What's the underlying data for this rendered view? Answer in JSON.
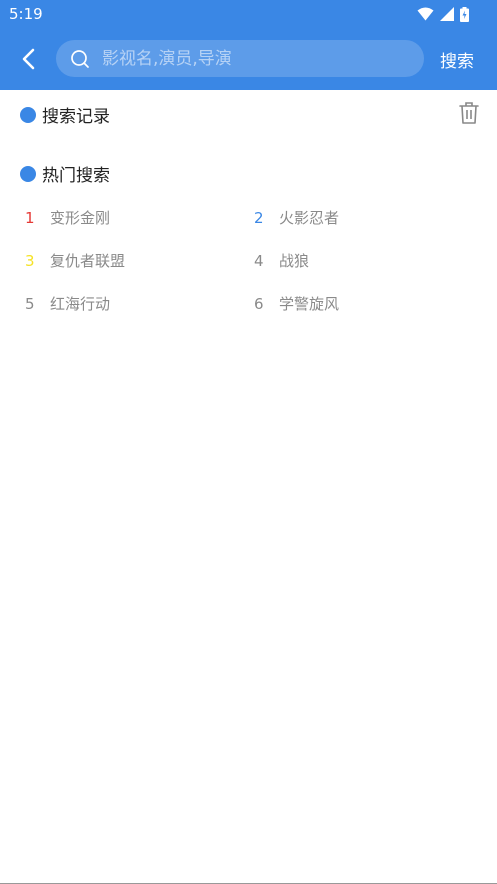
{
  "status_bar": {
    "time": "5:19"
  },
  "header": {
    "search_placeholder": "影视名,演员,导演",
    "search_value": "",
    "search_button": "搜索"
  },
  "history": {
    "title": "搜索记录"
  },
  "hot": {
    "title": "热门搜索",
    "items": [
      {
        "rank": "1",
        "label": "变形金刚",
        "rank_color": "#e53935"
      },
      {
        "rank": "2",
        "label": "火影忍者",
        "rank_color": "#3a87e5"
      },
      {
        "rank": "3",
        "label": "复仇者联盟",
        "rank_color": "#f5e326"
      },
      {
        "rank": "4",
        "label": "战狼",
        "rank_color": "#8a8a8a"
      },
      {
        "rank": "5",
        "label": "红海行动",
        "rank_color": "#8a8a8a"
      },
      {
        "rank": "6",
        "label": "学警旋风",
        "rank_color": "#8a8a8a"
      }
    ]
  },
  "colors": {
    "accent": "#3a87e5"
  }
}
